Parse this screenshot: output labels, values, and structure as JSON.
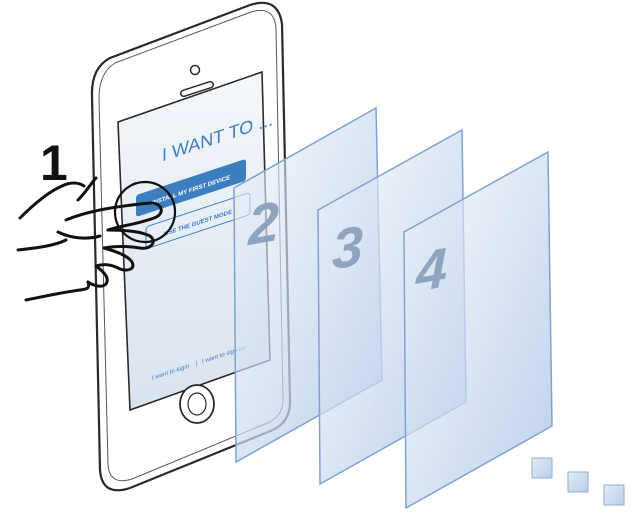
{
  "step_numbers": [
    "1",
    "2",
    "3",
    "4"
  ],
  "phone": {
    "heading": "I WANT TO ...",
    "primary_button_label": "INSTALL MY FIRST DEVICE",
    "secondary_button_label": "USE THE GUEST MODE",
    "footer_login": "I want to login",
    "footer_separator": "|",
    "footer_signup": "I want to sign up"
  },
  "colors": {
    "accent": "#3d7ec0",
    "panel_fill": "#cfdcef",
    "panel_border": "#7fa3d0",
    "number_gray": "#8fa4bf",
    "phone_outline": "#2a2a2a",
    "screen_bg": "#e9eef5"
  },
  "icons": {
    "hand": "pointing-hand-icon",
    "home_button": "home-button-icon",
    "trailing_squares": "small-square-icon"
  }
}
